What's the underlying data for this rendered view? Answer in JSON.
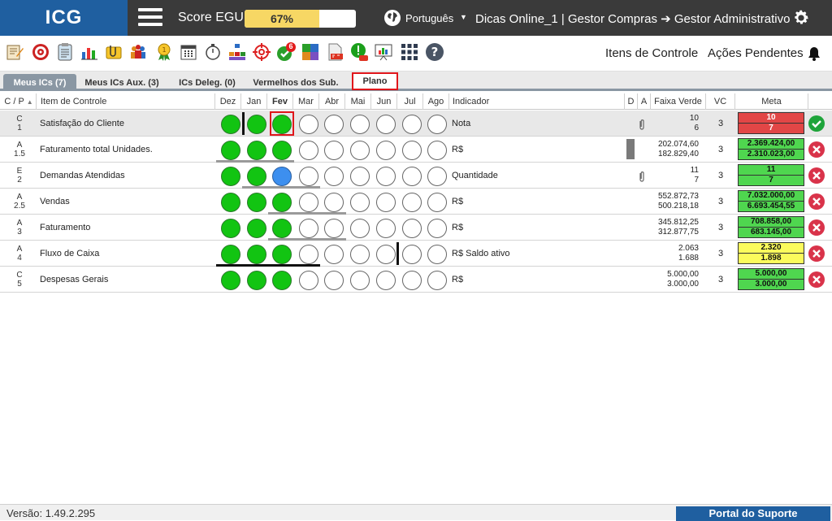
{
  "header": {
    "logo": "ICG",
    "score_label": "Score EGU:",
    "score_value": "67%",
    "score_fraction": 0.67,
    "language": "Português",
    "user_path": "Dicas Online_1  |  Gestor Compras ➔ Gestor Administrativo"
  },
  "toolbar": {
    "notification_count": "6",
    "itens_controle": "Itens de Controle",
    "acoes_pendentes": "Ações Pendentes"
  },
  "tabs": [
    {
      "label": "Meus ICs (7)"
    },
    {
      "label": "Meus ICs Aux. (3)"
    },
    {
      "label": "ICs Deleg. (0)"
    },
    {
      "label": "Vermelhos dos Sub."
    },
    {
      "label": "Plano"
    }
  ],
  "columns": {
    "cp": "C / P",
    "item": "Item de Controle",
    "months": [
      "Dez",
      "Jan",
      "Fev",
      "Mar",
      "Abr",
      "Mai",
      "Jun",
      "Jul",
      "Ago"
    ],
    "indicador": "Indicador",
    "d": "D",
    "a": "A",
    "faixa": "Faixa Verde",
    "vc": "VC",
    "meta": "Meta"
  },
  "rows": [
    {
      "c": "C",
      "p": "1",
      "item": "Satisfação do Cliente",
      "indicador": "Nota",
      "faixa1": "10",
      "faixa2": "6",
      "vc": "3",
      "meta1": "10",
      "meta2": "7"
    },
    {
      "c": "A",
      "p": "1.5",
      "item": "Faturamento total Unidades.",
      "indicador": "R$",
      "faixa1": "202.074,60",
      "faixa2": "182.829,40",
      "vc": "3",
      "meta1": "2.369.424,00",
      "meta2": "2.310.023,00"
    },
    {
      "c": "E",
      "p": "2",
      "item": "Demandas Atendidas",
      "indicador": "Quantidade",
      "faixa1": "11",
      "faixa2": "7",
      "vc": "3",
      "meta1": "11",
      "meta2": "7"
    },
    {
      "c": "A",
      "p": "2.5",
      "item": "Vendas",
      "indicador": "R$",
      "faixa1": "552.872,73",
      "faixa2": "500.218,18",
      "vc": "3",
      "meta1": "7.032.000,00",
      "meta2": "6.693.454,55"
    },
    {
      "c": "A",
      "p": "3",
      "item": "Faturamento",
      "indicador": "R$",
      "faixa1": "345.812,25",
      "faixa2": "312.877,75",
      "vc": "3",
      "meta1": "708.858,00",
      "meta2": "683.145,00"
    },
    {
      "c": "A",
      "p": "4",
      "item": "Fluxo de Caixa",
      "indicador": "R$ Saldo ativo",
      "faixa1": "2.063",
      "faixa2": "1.688",
      "vc": "3",
      "meta1": "2.320",
      "meta2": "1.898"
    },
    {
      "c": "C",
      "p": "5",
      "item": "Despesas Gerais",
      "indicador": "R$",
      "faixa1": "5.000,00",
      "faixa2": "3.000,00",
      "vc": "3",
      "meta1": "5.000,00",
      "meta2": "3.000,00"
    }
  ],
  "footer": {
    "version": "Versão: 1.49.2.295",
    "portal": "Portal do Suporte"
  }
}
